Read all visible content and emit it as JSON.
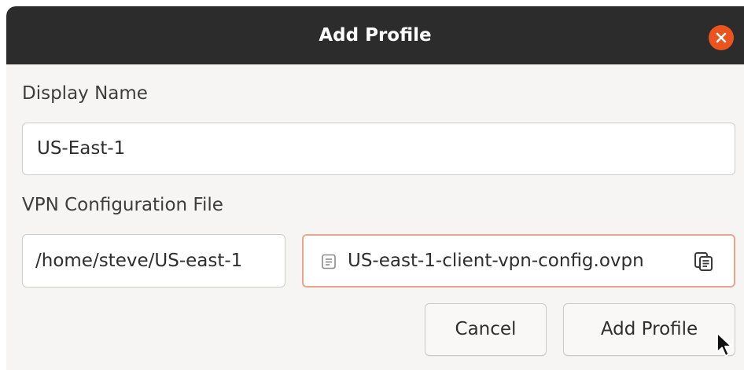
{
  "dialog": {
    "title": "Add Profile",
    "close_icon": "close-icon",
    "accent_color": "#e9541f"
  },
  "form": {
    "display_name_label": "Display Name",
    "display_name_value": "US-East-1",
    "vpn_config_label": "VPN Configuration File",
    "vpn_path_value": "/home/steve/US-east-1",
    "file_chooser": {
      "file_name": "US-east-1-client-vpn-config.ovpn",
      "file_icon": "document-icon",
      "action_icon": "copy-icon"
    }
  },
  "buttons": {
    "cancel_label": "Cancel",
    "add_profile_label": "Add Profile"
  },
  "pointer": "mouse-pointer-icon"
}
